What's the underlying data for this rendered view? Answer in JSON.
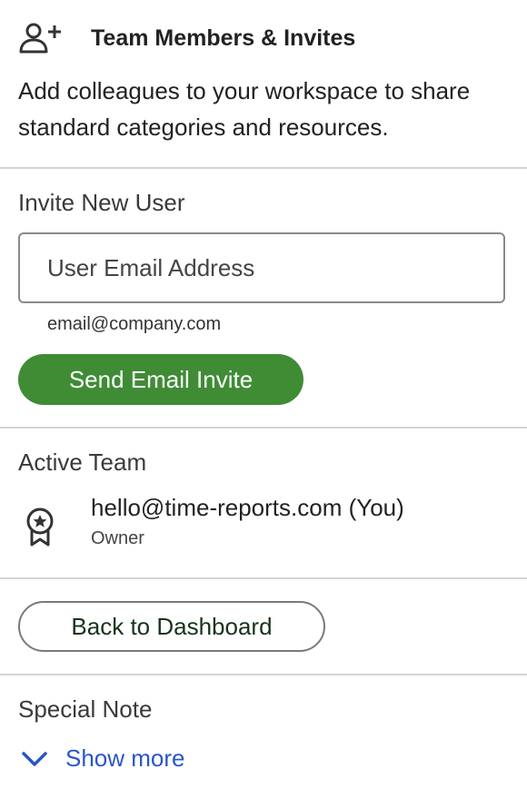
{
  "header": {
    "icon": "add-user-icon",
    "title": "Team Members & Invites"
  },
  "intro": {
    "text": "Add colleagues to your workspace to share standard categories and resources."
  },
  "invite": {
    "label": "Invite New User",
    "email_placeholder": "User Email Address",
    "email_value": "",
    "hint": "email@company.com",
    "send_label": "Send Email Invite",
    "send_color": "#3f8c35"
  },
  "team": {
    "label": "Active Team",
    "members": [
      {
        "email": "hello@time-reports.com (You)",
        "role": "Owner",
        "icon": "badge-icon"
      }
    ]
  },
  "actions": {
    "back_label": "Back to Dashboard"
  },
  "note": {
    "label": "Special Note",
    "toggle_label": "Show more",
    "toggle_icon": "chevron-down-icon",
    "link_color": "#2a56c6"
  }
}
